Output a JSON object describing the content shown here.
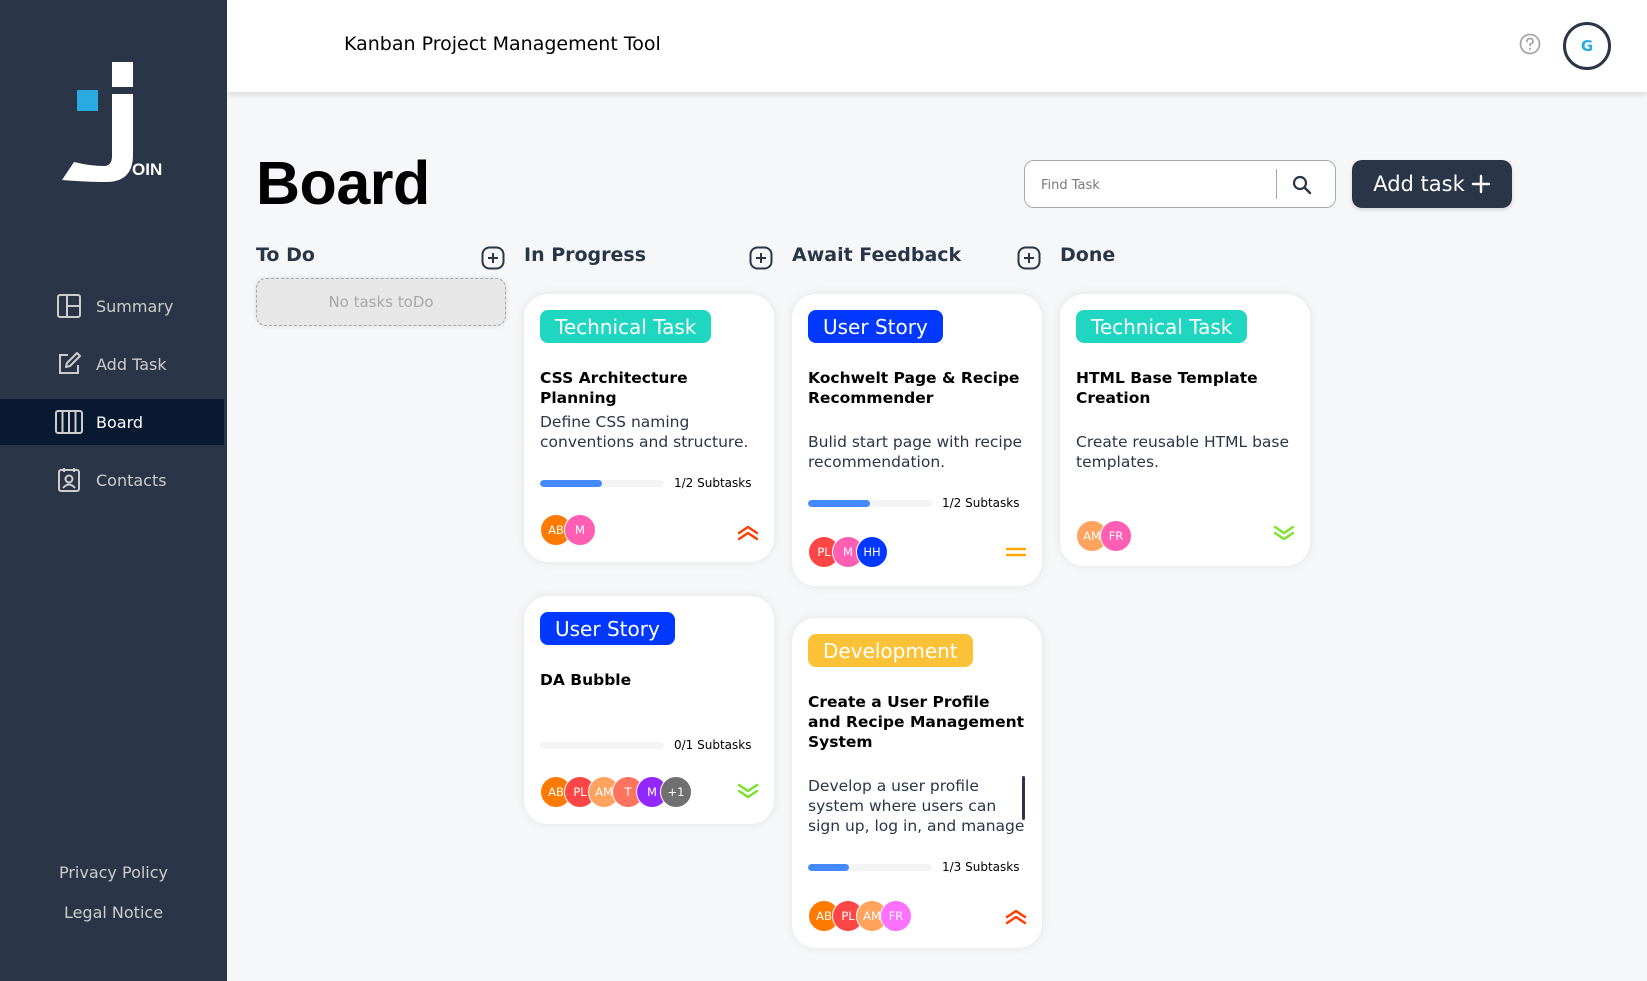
{
  "app": {
    "title": "Kanban Project Management Tool",
    "logo_text": "OIN"
  },
  "user": {
    "initials": "G"
  },
  "nav": [
    {
      "label": "Summary",
      "icon": "summary-icon"
    },
    {
      "label": "Add Task",
      "icon": "add-task-icon"
    },
    {
      "label": "Board",
      "icon": "board-icon",
      "active": true
    },
    {
      "label": "Contacts",
      "icon": "contacts-icon"
    }
  ],
  "footer_links": {
    "privacy": "Privacy Policy",
    "legal": "Legal Notice"
  },
  "board": {
    "title": "Board",
    "search_placeholder": "Find Task",
    "add_task_label": "Add task"
  },
  "columns": {
    "todo": {
      "title": "To Do",
      "empty": "No tasks toDo"
    },
    "progress": {
      "title": "In Progress"
    },
    "feedback": {
      "title": "Await Feedback"
    },
    "done": {
      "title": "Done"
    }
  },
  "cards": {
    "css": {
      "category": "Technical Task",
      "title": "CSS Architecture Planning",
      "description": "Define CSS naming conventions and structure.",
      "subtasks": "1/2 Subtasks",
      "progress": 0.5,
      "assignees": [
        {
          "initials": "AB",
          "color": "#ff7a00"
        },
        {
          "initials": "M",
          "color": "#ff5eb3"
        }
      ],
      "priority": "urgent"
    },
    "bubble": {
      "category": "User Story",
      "title": "DA Bubble",
      "subtasks": "0/1 Subtasks",
      "progress": 0,
      "assignees": [
        {
          "initials": "AB",
          "color": "#ff7a00"
        },
        {
          "initials": "PL",
          "color": "#ff4646"
        },
        {
          "initials": "AM",
          "color": "#ffa35e"
        },
        {
          "initials": "T",
          "color": "#ff745e"
        },
        {
          "initials": "M",
          "color": "#9327ff"
        },
        {
          "initials": "+1",
          "color": "#707070"
        }
      ],
      "priority": "low"
    },
    "kochwelt": {
      "category": "User Story",
      "title": "Kochwelt Page & Recipe Recommender",
      "description": "Bulid start page with recipe recommendation.",
      "subtasks": "1/2 Subtasks",
      "progress": 0.5,
      "assignees": [
        {
          "initials": "PL",
          "color": "#ff4646"
        },
        {
          "initials": "M",
          "color": "#ff5eb3"
        },
        {
          "initials": "HH",
          "color": "#0038ff"
        }
      ],
      "priority": "medium"
    },
    "profile": {
      "category": "Development",
      "title": "Create a User Profile and Recipe Management System",
      "description": "Develop a user profile system where users can sign up, log in, and manage",
      "subtasks": "1/3 Subtasks",
      "progress": 0.333,
      "assignees": [
        {
          "initials": "AB",
          "color": "#ff7a00"
        },
        {
          "initials": "PL",
          "color": "#ff4646"
        },
        {
          "initials": "AM",
          "color": "#ffa35e"
        },
        {
          "initials": "FR",
          "color": "#fc71ff"
        }
      ],
      "priority": "urgent"
    },
    "html": {
      "category": "Technical Task",
      "title": "HTML Base Template Creation",
      "description": "Create reusable HTML base templates.",
      "assignees": [
        {
          "initials": "AM",
          "color": "#ffa35e"
        },
        {
          "initials": "FR",
          "color": "#ff5eb3"
        }
      ],
      "priority": "low"
    }
  },
  "colors": {
    "sidebar": "#2a3647",
    "active_nav": "#091931",
    "technical": "#1fd7c1",
    "story": "#0038ff",
    "development": "#fcc237",
    "urgent": "#ff3d00",
    "medium": "#ffa800",
    "low": "#7ae229"
  }
}
